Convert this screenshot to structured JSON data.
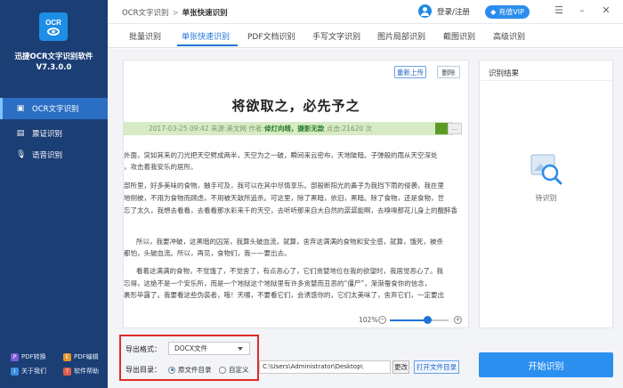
{
  "colors": {
    "sidebar": "#1b3e75",
    "accent": "#1e73d8",
    "export_border": "#e02b2b",
    "start_button": "#2b8ff0"
  },
  "app": {
    "logo": "OCR",
    "name": "迅捷OCR文字识别软件",
    "version": "V7.3.0.0"
  },
  "sidebar": {
    "items": [
      {
        "label": "OCR文字识别",
        "icon": "text-scan-icon",
        "active": true
      },
      {
        "label": "票证识别",
        "icon": "card-icon",
        "active": false
      },
      {
        "label": "语音识别",
        "icon": "microphone-icon",
        "active": false
      }
    ],
    "tools": [
      {
        "label": "PDF转换",
        "icon": "pdf-convert-icon"
      },
      {
        "label": "PDF编辑",
        "icon": "pdf-edit-icon"
      },
      {
        "label": "关于我们",
        "icon": "about-icon"
      },
      {
        "label": "软件帮助",
        "icon": "help-icon"
      }
    ]
  },
  "topbar": {
    "breadcrumb_root": "OCR文字识别",
    "breadcrumb_sep": ">",
    "breadcrumb_current": "单张快速识别",
    "login": "登录/注册",
    "vip": "充值VIP"
  },
  "tabs": [
    {
      "label": "批量识别",
      "active": false
    },
    {
      "label": "单张快速识别",
      "active": true
    },
    {
      "label": "PDF文档识别",
      "active": false
    },
    {
      "label": "手写文字识别",
      "active": false
    },
    {
      "label": "图片局部识别",
      "active": false
    },
    {
      "label": "截图识别",
      "active": false
    },
    {
      "label": "高级识别",
      "active": false
    }
  ],
  "document": {
    "reupload": "重新上传",
    "delete": "删除",
    "title": "将欲取之，必先予之",
    "meta_prefix": "2017-03-25 09:42  来源:美文网  作者:",
    "meta_author": "倬灯向晴，摄影无款",
    "meta_suffix": "  点击:21620 次",
    "meta_btn": "...",
    "lines": [
      "外面，突如其来的刀光把天空劈成两半，天空为之一破，瞬间来云密布，天地陡暗。子弹般的雨从天空深处",
      "，攻击着我安乐的居所。",
      "部所里，好多美味的食物，触手可及，我可以在其中尽情享乐。部般断阳光的鼻子为我挡下雨的侵袭，我在里",
      "地侧被，不用为食物而顾虑，不用被天敌所追杀。可这里，除了黑暗，依旧，黑暗。除了食物，还是食物，世",
      "忘了太久，我想去看看，去看看那水彩来千的天空，去听听那来自大自然的潺潺能啊，去嗅嗅那花儿身上的醒醉香",
      "所以，我要冲破，这黑暗的囚笼，我算头破血流，就算，舍弃这满满的食物和安全感，就算，饿死，被杀",
      "都怕，头破血流。所以，再见，食物们，我——要出去。",
      "看着这满满的食物，不觉饿了，不觉舍了，有点恶心了，它们贪婪地位在我的欲望时，我居觉恶心了。我",
      "忘得，这绝不是一个安乐所，而是一个地狱这个地狱里有许多贪婪而丑恶的“僵尸”，渐渐蚕食你的信念，",
      "裹形毕露了。我要看这些伪装者，哦！天哪，不要看它们，会诱惑你的，它们太美味了，舍弃它们，一定要出"
    ]
  },
  "zoom": {
    "label": "102%",
    "minus": "−",
    "plus": "+",
    "level_percent": 64
  },
  "result": {
    "title": "识别结果",
    "waiting": "待识别"
  },
  "export": {
    "format_label": "导出格式：",
    "format_value": "DOCX文件",
    "dir_label": "导出目录：",
    "opt_source": "原文件目录",
    "opt_custom": "自定义",
    "path": "C:\\Users\\Administrator\\Desktop\\",
    "change": "更改",
    "open_dir": "打开文件目录"
  },
  "start": "开始识别"
}
